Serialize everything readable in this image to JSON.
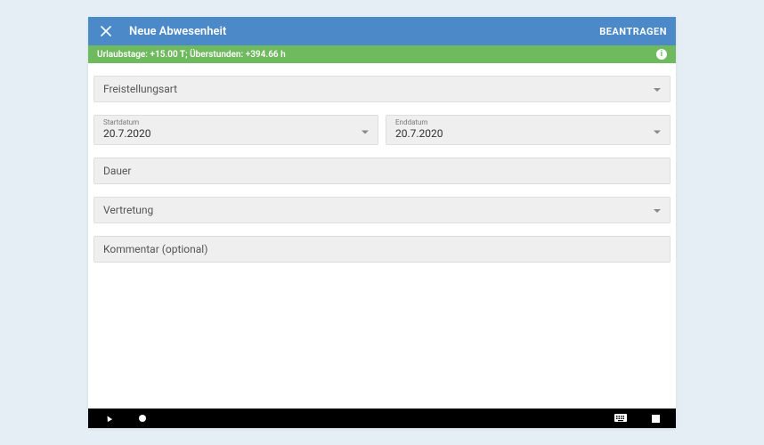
{
  "header": {
    "title": "Neue Abwesenheit",
    "submit_label": "BEANTRAGEN"
  },
  "status": {
    "text": "Urlaubstage: +15.00 T; Überstunden: +394.66 h"
  },
  "fields": {
    "type_label": "Freistellungsart",
    "start_date_label": "Startdatum",
    "start_date_value": "20.7.2020",
    "end_date_label": "Enddatum",
    "end_date_value": "20.7.2020",
    "duration_label": "Dauer",
    "substitute_label": "Vertretung",
    "comment_label": "Kommentar (optional)"
  }
}
